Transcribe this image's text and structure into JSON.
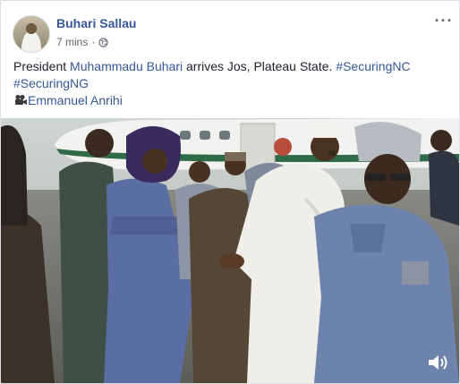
{
  "post": {
    "author": "Buhari Sallau",
    "time": "7 mins",
    "separator": "·",
    "privacy_icon": "globe-icon",
    "more_icon": "ellipsis-icon",
    "more_label": "···",
    "text": {
      "prefix": "President ",
      "mention": "Muhammadu Buhari",
      "middle": " arrives Jos, Plateau State. ",
      "hashtag1": "#SecuringNC",
      "hashtag2": "#SecuringNG",
      "camera_icon": "movie-camera-icon",
      "credit": "Emmanuel Anrihi"
    }
  },
  "video": {
    "sound_icon": "speaker-icon"
  },
  "colors": {
    "link": "#365899",
    "text": "#1d2129",
    "meta": "#616770",
    "border": "#dddfe2"
  }
}
